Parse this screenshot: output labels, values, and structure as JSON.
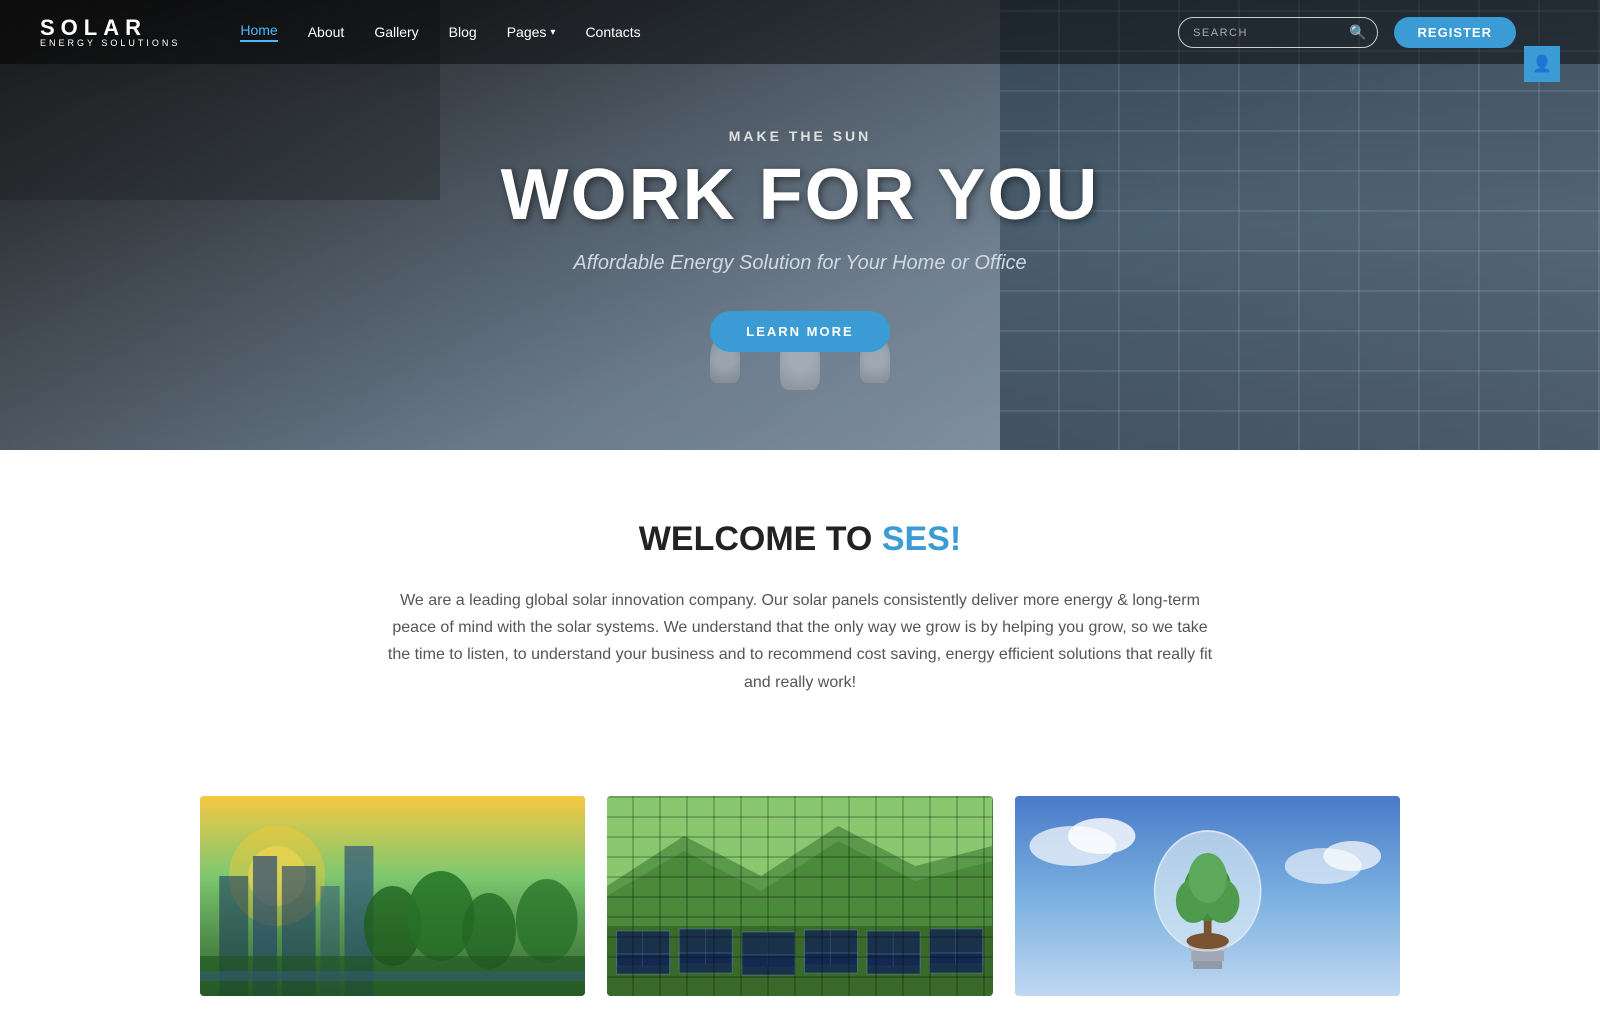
{
  "brand": {
    "name": "SOLAR",
    "tagline": "ENERGY SOLUTIONS"
  },
  "nav": {
    "links": [
      {
        "id": "home",
        "label": "Home",
        "active": true
      },
      {
        "id": "about",
        "label": "About",
        "active": false
      },
      {
        "id": "gallery",
        "label": "Gallery",
        "active": false
      },
      {
        "id": "blog",
        "label": "Blog",
        "active": false
      },
      {
        "id": "pages",
        "label": "Pages",
        "hasDropdown": true
      },
      {
        "id": "contacts",
        "label": "Contacts",
        "active": false
      }
    ],
    "search": {
      "placeholder": "SEARCH"
    },
    "register_label": "REGISTER"
  },
  "hero": {
    "subtitle": "MAKE THE SUN",
    "title": "WORK FOR YOU",
    "tagline": "Affordable Energy Solution for Your Home or Office",
    "cta_label": "LEARN MORE"
  },
  "welcome": {
    "heading_prefix": "WELCOME TO ",
    "heading_accent": "SES!",
    "body": "We are a leading global solar innovation company. Our solar panels consistently deliver more energy & long-term peace of mind with the solar systems. We understand that the only way we grow is by helping you grow, so we take the time to listen, to understand your business and to recommend cost saving, energy efficient solutions that really fit and really work!"
  },
  "cards": [
    {
      "id": "city-card",
      "alt": "City with solar panels and green trees"
    },
    {
      "id": "solar-field-card",
      "alt": "Solar panels in a green field"
    },
    {
      "id": "bulb-tree-card",
      "alt": "Light bulb with tree inside representing green energy"
    }
  ]
}
